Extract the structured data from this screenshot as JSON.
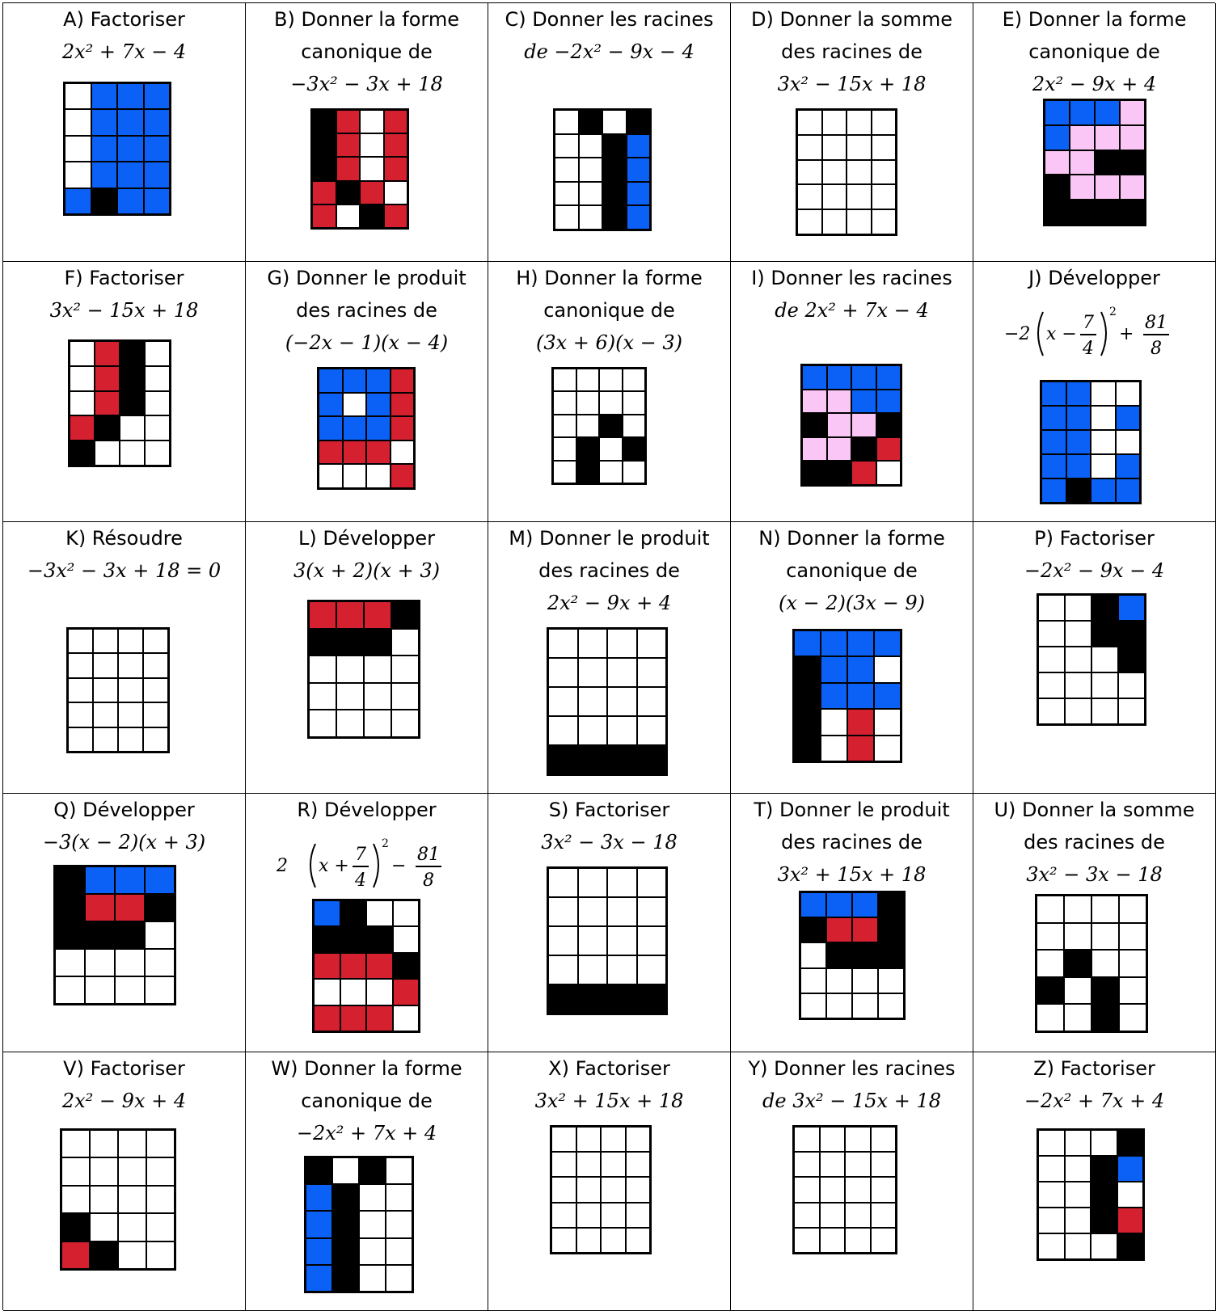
{
  "cells": [
    {
      "id": "A",
      "instruction_lines": [
        "A) Factoriser"
      ],
      "expression": "2x² + 7x − 4",
      "rows": 5,
      "cols": 4,
      "grid": [
        "wbbb",
        "wbbb",
        "wbbb",
        "wbbb",
        "bkbb"
      ]
    },
    {
      "id": "B",
      "instruction_lines": [
        "B) Donner la forme",
        "canonique de"
      ],
      "expression": "−3x² − 3x + 18",
      "rows": 5,
      "cols": 4,
      "grid": [
        "krwr",
        "krwr",
        "krwr",
        "rkrw",
        "rwkr"
      ]
    },
    {
      "id": "C",
      "instruction_lines": [
        "C) Donner les racines"
      ],
      "expression": "de  −2x² − 9x − 4",
      "rows": 5,
      "cols": 4,
      "grid": [
        "wkwk",
        "wwkb",
        "wwkb",
        "wwkb",
        "wwkb"
      ]
    },
    {
      "id": "D",
      "instruction_lines": [
        "D) Donner la somme",
        "des racines de"
      ],
      "expression": "3x² − 15x + 18",
      "rows": 5,
      "cols": 4,
      "grid": [
        "wwww",
        "wwww",
        "wwww",
        "wwww",
        "wwww"
      ]
    },
    {
      "id": "E",
      "instruction_lines": [
        "E) Donner la forme",
        "canonique de"
      ],
      "expression": "2x² − 9x + 4",
      "rows": 5,
      "cols": 4,
      "grid": [
        "bbbp",
        "bppp",
        "ppkk",
        "kppp",
        "kkkk"
      ]
    },
    {
      "id": "F",
      "instruction_lines": [
        "F) Factoriser"
      ],
      "expression": "3x² − 15x + 18",
      "rows": 5,
      "cols": 4,
      "grid": [
        "wrkw",
        "wrkw",
        "wrkw",
        "rkww",
        "kwww"
      ]
    },
    {
      "id": "G",
      "instruction_lines": [
        "G) Donner le produit",
        "des racines de"
      ],
      "expression": "(−2x − 1)(x − 4)",
      "rows": 5,
      "cols": 4,
      "grid": [
        "bbbr",
        "bwbr",
        "bbbr",
        "rrrw",
        "wwwr"
      ]
    },
    {
      "id": "H",
      "instruction_lines": [
        "H) Donner la forme",
        "canonique de"
      ],
      "expression": "(3x + 6)(x − 3)",
      "rows": 5,
      "cols": 4,
      "grid": [
        "wwww",
        "wwww",
        "wwkw",
        "wkwk",
        "wkww"
      ]
    },
    {
      "id": "I",
      "instruction_lines": [
        "I) Donner les racines"
      ],
      "expression": "de 2x² + 7x − 4",
      "rows": 5,
      "cols": 4,
      "grid": [
        "bbbb",
        "ppbb",
        "kppk",
        "ppkr",
        "kkrw"
      ]
    },
    {
      "id": "J",
      "instruction_lines": [
        "J) Développer"
      ],
      "expression": "",
      "rows": 5,
      "cols": 4,
      "grid": [
        "bbww",
        "bbwb",
        "bbww",
        "bbwb",
        "bkbb"
      ],
      "frac_expr": {
        "prefix": "−2",
        "inner_left": "x − ",
        "num": "7",
        "den": "4",
        "exp": "2",
        "op": " + ",
        "num2": "81",
        "den2": "8"
      }
    },
    {
      "id": "K",
      "instruction_lines": [
        "K) Résoudre"
      ],
      "expression": "−3x² − 3x + 18 = 0",
      "rows": 5,
      "cols": 4,
      "grid": [
        "wwww",
        "wwww",
        "wwww",
        "wwww",
        "wwww"
      ]
    },
    {
      "id": "L",
      "instruction_lines": [
        "L) Développer"
      ],
      "expression": "3(x + 2)(x + 3)",
      "rows": 5,
      "cols": 4,
      "grid": [
        "rrrk",
        "kkkw",
        "wwww",
        "wwww",
        "wwww"
      ]
    },
    {
      "id": "M",
      "instruction_lines": [
        "M) Donner le produit",
        "des racines de"
      ],
      "expression": "2x² − 9x + 4",
      "rows": 5,
      "cols": 4,
      "grid": [
        "wwww",
        "wwww",
        "wwww",
        "wwww",
        "kkkk"
      ]
    },
    {
      "id": "N",
      "instruction_lines": [
        "N) Donner la forme",
        "canonique de"
      ],
      "expression": "(x − 2)(3x − 9)",
      "rows": 5,
      "cols": 4,
      "grid": [
        "bbbb",
        "kbbw",
        "kbbb",
        "kwrw",
        "kwrw"
      ]
    },
    {
      "id": "P",
      "instruction_lines": [
        "P) Factoriser"
      ],
      "expression": "−2x² − 9x − 4",
      "rows": 5,
      "cols": 4,
      "grid": [
        "wwkb",
        "wwkk",
        "wwwk",
        "wwww",
        "wwww"
      ]
    },
    {
      "id": "Q",
      "instruction_lines": [
        "Q) Développer"
      ],
      "expression": "−3(x − 2)(x + 3)",
      "rows": 5,
      "cols": 4,
      "grid": [
        "kbbb",
        "krrk",
        "kkkw",
        "wwww",
        "wwww"
      ]
    },
    {
      "id": "R",
      "instruction_lines": [
        "R) Développer"
      ],
      "expression": "",
      "rows": 5,
      "cols": 4,
      "grid": [
        "bkww",
        "kkkw",
        "rrrk",
        "wwwr",
        "rrrw"
      ],
      "frac_expr": {
        "prefix": "2",
        "inner_left": "x + ",
        "num": "7",
        "den": "4",
        "exp": "2",
        "op": " − ",
        "num2": "81",
        "den2": "8"
      }
    },
    {
      "id": "S",
      "instruction_lines": [
        "S) Factoriser"
      ],
      "expression": "3x² − 3x − 18",
      "rows": 5,
      "cols": 4,
      "grid": [
        "wwww",
        "wwww",
        "wwww",
        "wwww",
        "kkkk"
      ]
    },
    {
      "id": "T",
      "instruction_lines": [
        "T) Donner le produit",
        "des racines de"
      ],
      "expression": "3x² + 15x + 18",
      "rows": 5,
      "cols": 4,
      "grid": [
        "bbbk",
        "krrk",
        "wkkk",
        "wwww",
        "wwww"
      ]
    },
    {
      "id": "U",
      "instruction_lines": [
        "U) Donner la somme",
        "des racines de"
      ],
      "expression": "3x² − 3x − 18",
      "rows": 5,
      "cols": 4,
      "grid": [
        "wwww",
        "wwww",
        "wkww",
        "kwkw",
        "wwkw"
      ]
    },
    {
      "id": "V",
      "instruction_lines": [
        "V) Factoriser"
      ],
      "expression": "2x² − 9x + 4",
      "rows": 5,
      "cols": 4,
      "grid": [
        "wwww",
        "wwww",
        "wwww",
        "kwww",
        "rkww"
      ]
    },
    {
      "id": "W",
      "instruction_lines": [
        "W) Donner la forme",
        "canonique de"
      ],
      "expression": "−2x² + 7x + 4",
      "rows": 5,
      "cols": 4,
      "grid": [
        "kwkw",
        "bkww",
        "bkww",
        "bkww",
        "bkww"
      ]
    },
    {
      "id": "X",
      "instruction_lines": [
        "X) Factoriser"
      ],
      "expression": "3x² + 15x + 18",
      "rows": 5,
      "cols": 4,
      "grid": [
        "wwww",
        "wwww",
        "wwww",
        "wwww",
        "wwww"
      ]
    },
    {
      "id": "Y",
      "instruction_lines": [
        "Y) Donner les racines"
      ],
      "expression": "de  3x² − 15x + 18",
      "rows": 5,
      "cols": 4,
      "grid": [
        "wwww",
        "wwww",
        "wwww",
        "wwww",
        "wwww"
      ]
    },
    {
      "id": "Z",
      "instruction_lines": [
        "Z) Factoriser"
      ],
      "expression": "−2x² + 7x + 4",
      "rows": 5,
      "cols": 4,
      "grid": [
        "wwwk",
        "wwkb",
        "wwkw",
        "wwkr",
        "wwwk"
      ]
    }
  ],
  "color_legend": {
    "w": "#ffffff",
    "b": "#0b61f5",
    "k": "#000000",
    "r": "#d5202f",
    "p": "#f9c6f5"
  }
}
